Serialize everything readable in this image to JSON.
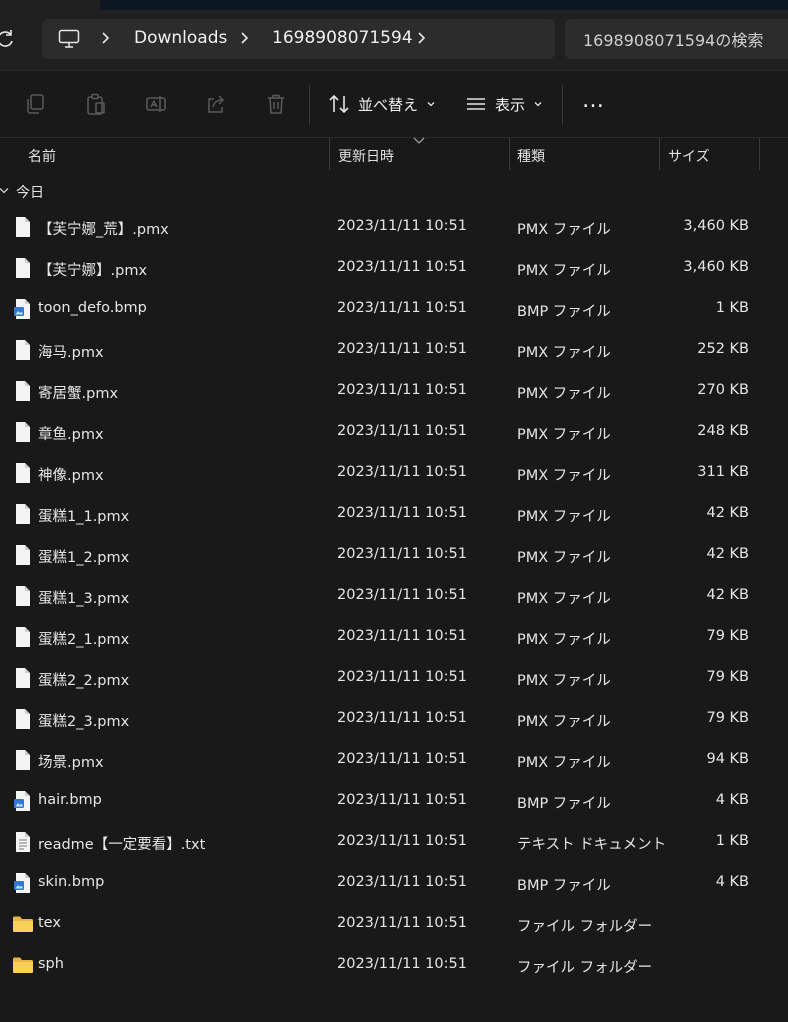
{
  "address_bar": {
    "crumbs": [
      "Downloads",
      "1698908071594"
    ],
    "search_placeholder": "1698908071594の検索"
  },
  "toolbar": {
    "sort_label": "並べ替え",
    "view_label": "表示",
    "more_label": "…"
  },
  "columns": {
    "name": "名前",
    "modified": "更新日時",
    "type": "種類",
    "size": "サイズ"
  },
  "group": {
    "label": "今日"
  },
  "files": [
    {
      "name": "【芙宁娜_荒】.pmx",
      "modified": "2023/11/11 10:51",
      "type": "PMX ファイル",
      "size": "3,460 KB",
      "icon": "document-icon"
    },
    {
      "name": "【芙宁娜】.pmx",
      "modified": "2023/11/11 10:51",
      "type": "PMX ファイル",
      "size": "3,460 KB",
      "icon": "document-icon"
    },
    {
      "name": "toon_defo.bmp",
      "modified": "2023/11/11 10:51",
      "type": "BMP ファイル",
      "size": "1 KB",
      "icon": "image-file-icon"
    },
    {
      "name": "海马.pmx",
      "modified": "2023/11/11 10:51",
      "type": "PMX ファイル",
      "size": "252 KB",
      "icon": "document-icon"
    },
    {
      "name": "寄居蟹.pmx",
      "modified": "2023/11/11 10:51",
      "type": "PMX ファイル",
      "size": "270 KB",
      "icon": "document-icon"
    },
    {
      "name": "章鱼.pmx",
      "modified": "2023/11/11 10:51",
      "type": "PMX ファイル",
      "size": "248 KB",
      "icon": "document-icon"
    },
    {
      "name": "神像.pmx",
      "modified": "2023/11/11 10:51",
      "type": "PMX ファイル",
      "size": "311 KB",
      "icon": "document-icon"
    },
    {
      "name": "蛋糕1_1.pmx",
      "modified": "2023/11/11 10:51",
      "type": "PMX ファイル",
      "size": "42 KB",
      "icon": "document-icon"
    },
    {
      "name": "蛋糕1_2.pmx",
      "modified": "2023/11/11 10:51",
      "type": "PMX ファイル",
      "size": "42 KB",
      "icon": "document-icon"
    },
    {
      "name": "蛋糕1_3.pmx",
      "modified": "2023/11/11 10:51",
      "type": "PMX ファイル",
      "size": "42 KB",
      "icon": "document-icon"
    },
    {
      "name": "蛋糕2_1.pmx",
      "modified": "2023/11/11 10:51",
      "type": "PMX ファイル",
      "size": "79 KB",
      "icon": "document-icon"
    },
    {
      "name": "蛋糕2_2.pmx",
      "modified": "2023/11/11 10:51",
      "type": "PMX ファイル",
      "size": "79 KB",
      "icon": "document-icon"
    },
    {
      "name": "蛋糕2_3.pmx",
      "modified": "2023/11/11 10:51",
      "type": "PMX ファイル",
      "size": "79 KB",
      "icon": "document-icon"
    },
    {
      "name": "场景.pmx",
      "modified": "2023/11/11 10:51",
      "type": "PMX ファイル",
      "size": "94 KB",
      "icon": "document-icon"
    },
    {
      "name": "hair.bmp",
      "modified": "2023/11/11 10:51",
      "type": "BMP ファイル",
      "size": "4 KB",
      "icon": "image-file-icon"
    },
    {
      "name": "readme【一定要看】.txt",
      "modified": "2023/11/11 10:51",
      "type": "テキスト ドキュメント",
      "size": "1 KB",
      "icon": "text-file-icon"
    },
    {
      "name": "skin.bmp",
      "modified": "2023/11/11 10:51",
      "type": "BMP ファイル",
      "size": "4 KB",
      "icon": "image-file-icon"
    },
    {
      "name": "tex",
      "modified": "2023/11/11 10:51",
      "type": "ファイル フォルダー",
      "size": "",
      "icon": "folder-icon"
    },
    {
      "name": "sph",
      "modified": "2023/11/11 10:51",
      "type": "ファイル フォルダー",
      "size": "",
      "icon": "folder-icon"
    }
  ]
}
